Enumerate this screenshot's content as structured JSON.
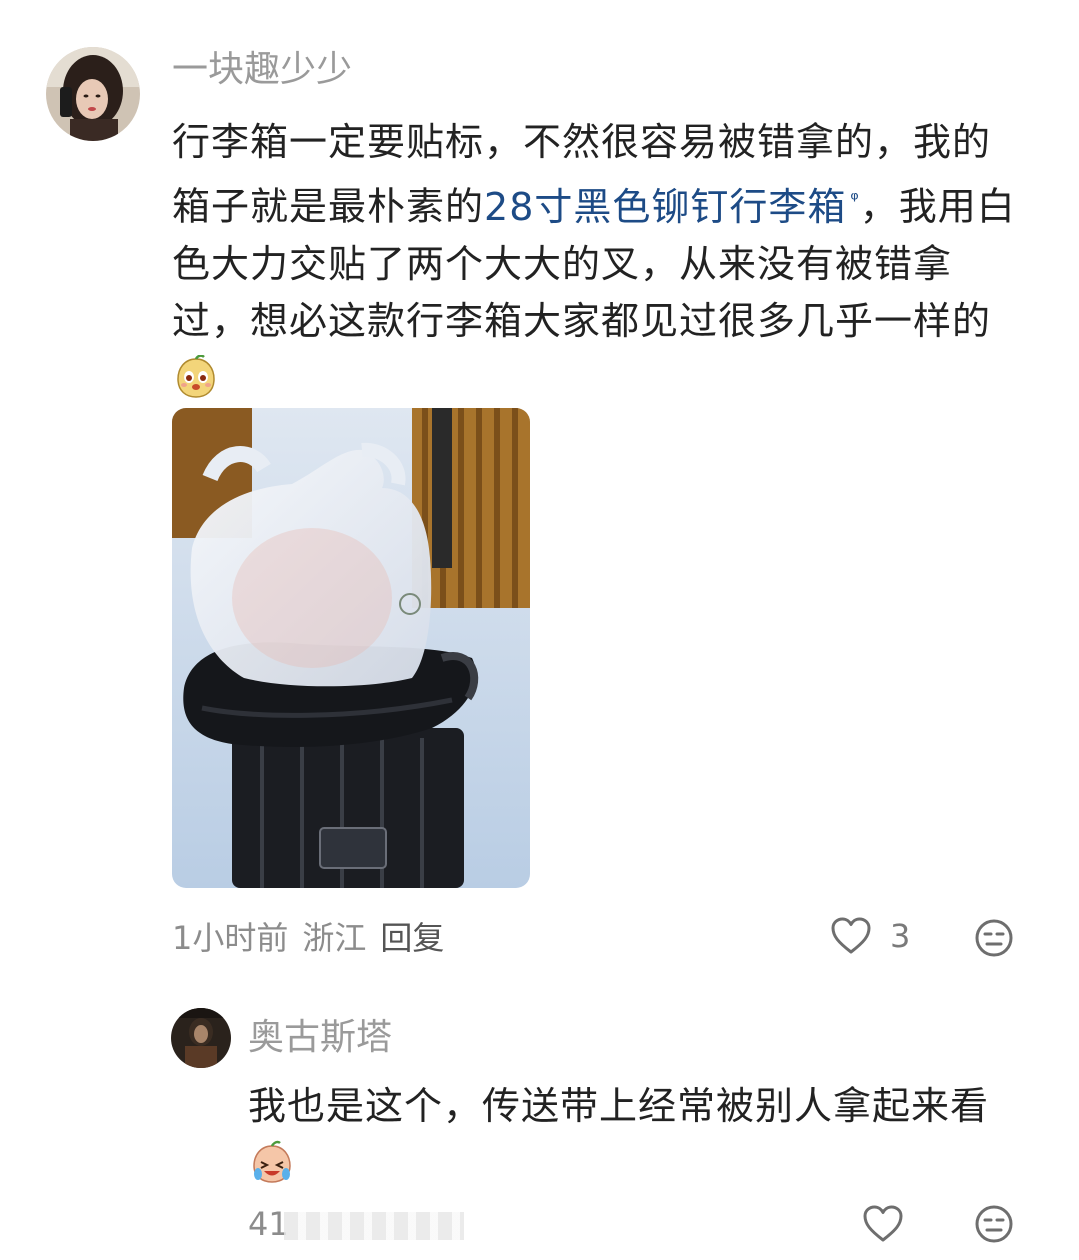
{
  "comment": {
    "username": "一块趣少少",
    "text_before_link": "行李箱一定要贴标，不然很容易被错拿的，我的箱子就是最朴素的",
    "link_text": "28寸黑色铆钉行李箱",
    "link_search_glyph": "ᵠ",
    "text_after_link": "，我用白色大力交贴了两个大大的叉，从来没有被错拿过，想必这款行李箱大家都见过很多几乎一样的",
    "emoji_name": "potato-face-emoji",
    "photo_alt": "black suitcase with white bag",
    "time": "1小时前",
    "location": "浙江",
    "reply_label": "回复",
    "like_count": "3"
  },
  "reply": {
    "username": "奥古斯塔",
    "text": "我也是这个，传送带上经常被别人拿起来看",
    "emoji_name": "crying-laughing-emoji",
    "time_partial": "41"
  },
  "icons": {
    "like": "heart-outline-icon",
    "dislike": "neutral-face-icon"
  },
  "colors": {
    "link": "#1d4b86",
    "meta": "#8c8c8c",
    "username": "#9a9a9a",
    "text": "#222222"
  }
}
